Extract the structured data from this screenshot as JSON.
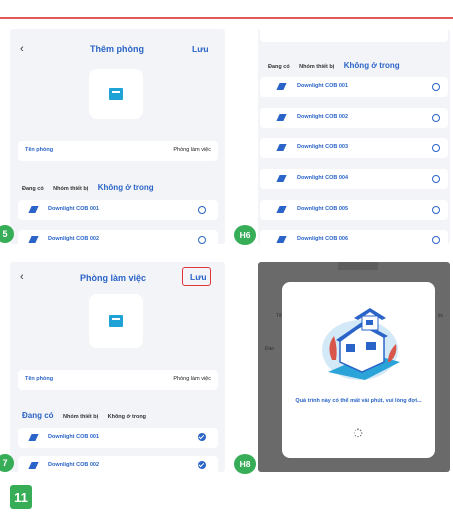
{
  "panel5": {
    "title": "Thêm phòng",
    "save": "Lưu",
    "name_label": "Tên phòng",
    "name_value": "Phòng làm việc",
    "tabs": [
      "Đang có",
      "Nhóm thiết bị",
      "Không ở trong"
    ],
    "active_tab": 2,
    "devices": [
      "Downlight COB 001",
      "Downlight COB 002"
    ]
  },
  "panel6": {
    "tabs": [
      "Đang có",
      "Nhóm thiết bị",
      "Không ở trong"
    ],
    "active_tab": 2,
    "devices": [
      "Downlight COB 001",
      "Downlight COB 002",
      "Downlight COB 003",
      "Downlight COB 004",
      "Downlight COB 005",
      "Downlight COB 006"
    ]
  },
  "panel7": {
    "title": "Phòng làm việc",
    "save": "Lưu",
    "name_label": "Tên phòng",
    "name_value": "Phòng làm việc",
    "tabs": [
      "Đang có",
      "Nhóm thiết bị",
      "Không ở trong"
    ],
    "active_tab": 0,
    "devices": [
      "Downlight COB 001",
      "Downlight COB 002"
    ]
  },
  "panel8": {
    "bg_fragments": [
      "Tê",
      "Đan",
      "ệc"
    ],
    "message": "Quá trình này có thể mất vài phút, vui lòng đợi..."
  },
  "badges": [
    "5",
    "H6",
    "7",
    "H8"
  ],
  "page_number": "11",
  "colors": {
    "accent": "#2a64c8",
    "badge": "#37ad57",
    "highlight": "#e0343a",
    "rule": "#e2595b"
  }
}
